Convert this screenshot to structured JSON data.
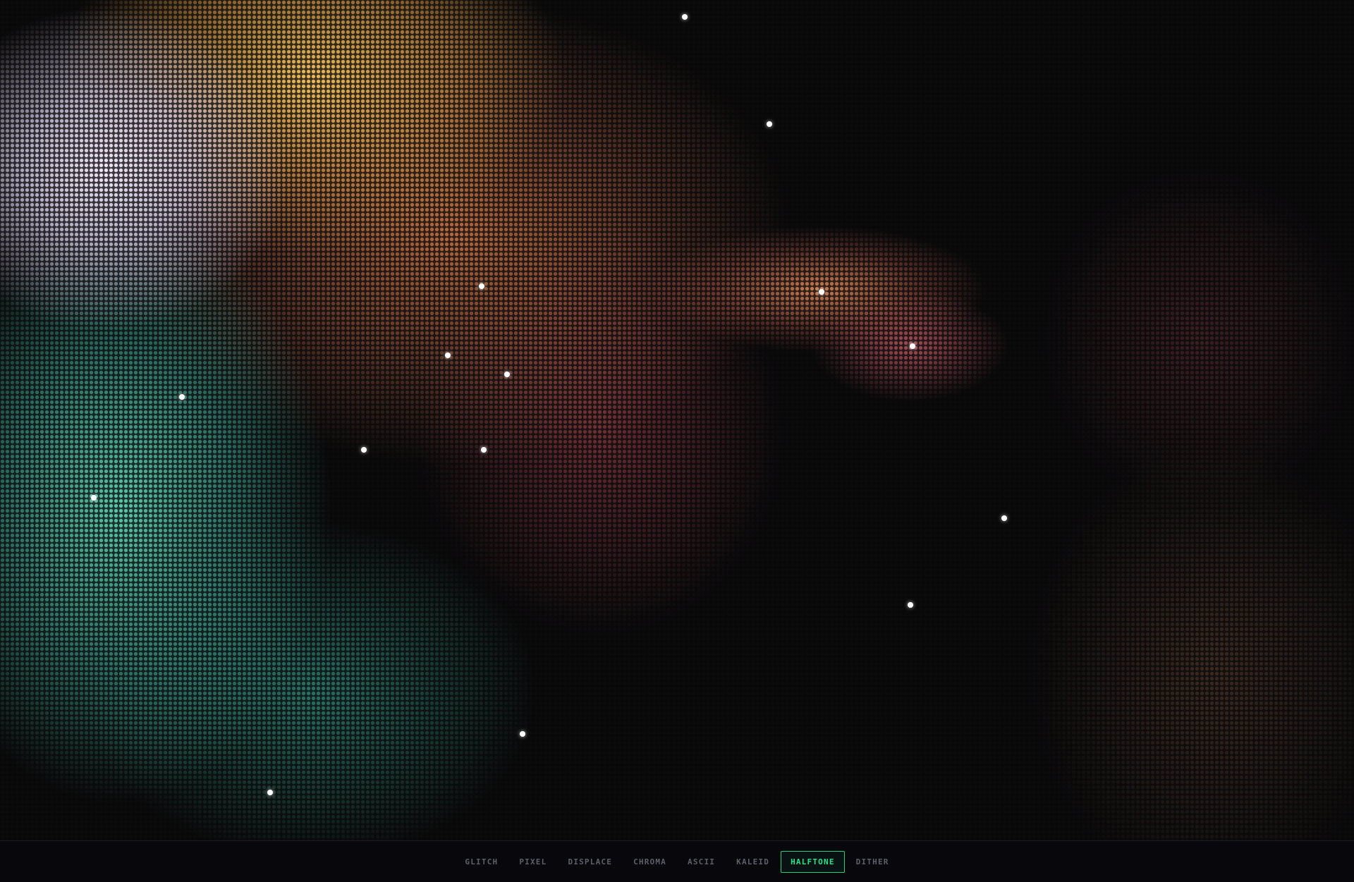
{
  "modes": {
    "tabs": [
      {
        "label": "GLITCH"
      },
      {
        "label": "PIXEL"
      },
      {
        "label": "DISPLACE"
      },
      {
        "label": "CHROMA"
      },
      {
        "label": "ASCII"
      },
      {
        "label": "KALEID"
      },
      {
        "label": "HALFTONE"
      },
      {
        "label": "DITHER"
      }
    ],
    "active": "HALFTONE",
    "accent_color": "#27e38c"
  }
}
